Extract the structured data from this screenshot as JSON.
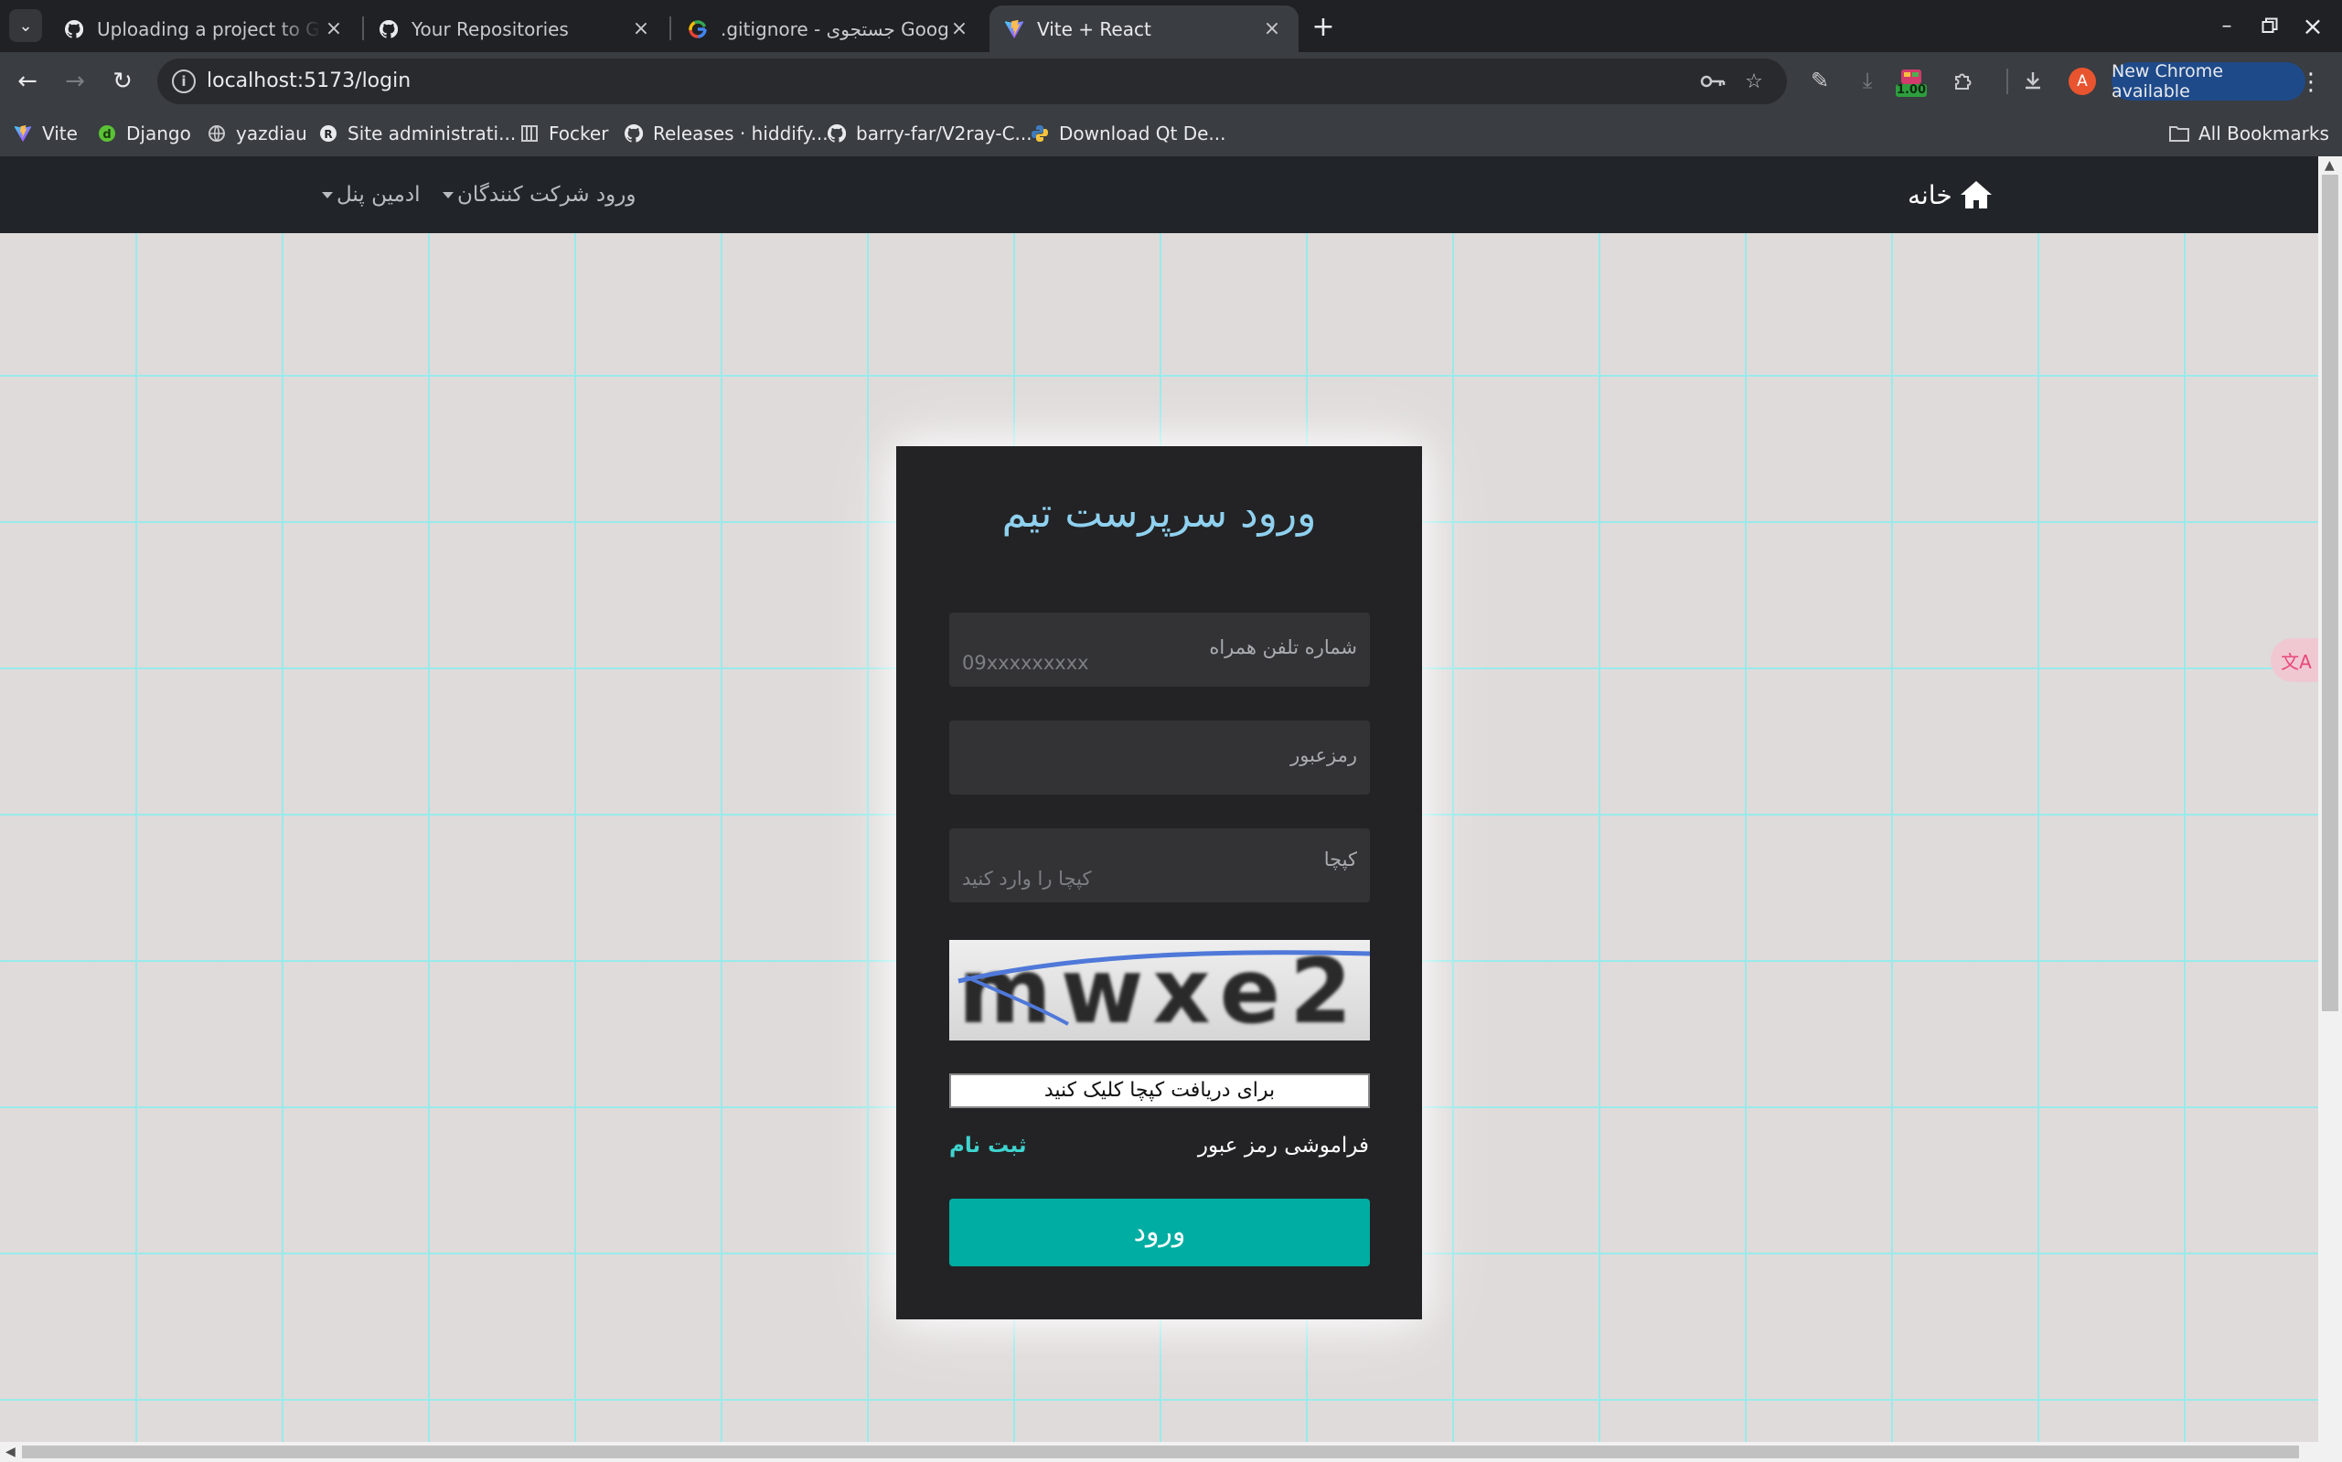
{
  "browser": {
    "tabs": [
      {
        "title": "Uploading a project to GitHub",
        "icon": "github-icon",
        "active": false
      },
      {
        "title": "Your Repositories",
        "icon": "github-icon",
        "active": false
      },
      {
        "title": ".gitignore - جستجوی Google",
        "icon": "google-icon",
        "active": false
      },
      {
        "title": "Vite + React",
        "icon": "vite-icon",
        "active": true
      }
    ],
    "url": "localhost:5173/login",
    "extension_badge": "1.00",
    "profile_initial": "A",
    "update_label": "New Chrome available",
    "bookmarks": [
      {
        "label": "Vite",
        "icon": "vite-icon"
      },
      {
        "label": "Django",
        "icon": "django-icon"
      },
      {
        "label": "yazdiau",
        "icon": "globe-icon"
      },
      {
        "label": "Site administrati...",
        "icon": "site-admin-icon"
      },
      {
        "label": "Focker",
        "icon": "focker-icon"
      },
      {
        "label": "Releases · hiddify...",
        "icon": "github-icon"
      },
      {
        "label": "barry-far/V2ray-C...",
        "icon": "github-icon"
      },
      {
        "label": "Download Qt De...",
        "icon": "python-icon"
      }
    ],
    "all_bookmarks_label": "All Bookmarks"
  },
  "site_nav": {
    "home_label": "خانه",
    "participants_login": "ورود شرکت کنندگان",
    "admin_panel": "ادمین پنل"
  },
  "login_card": {
    "title": "ورود سرپرست تیم",
    "phone": {
      "label": "شماره تلفن همراه",
      "placeholder": "09xxxxxxxxx"
    },
    "password": {
      "label": "رمزعبور",
      "placeholder": ""
    },
    "captcha": {
      "label": "کپچا",
      "placeholder": "کپچا را وارد کنید"
    },
    "captcha_image_text": "mwxe2",
    "captcha_button": "برای دریافت کپچا کلیک کنید",
    "forgot_password": "فراموشی رمز عبور",
    "signup": "ثبت نام",
    "submit": "ورود"
  },
  "colors": {
    "title": "#8fd1ef",
    "submit_button": "#00ada2",
    "signup_link": "#3fd3cf",
    "card_bg": "#232325",
    "navbar_bg": "#212529"
  }
}
